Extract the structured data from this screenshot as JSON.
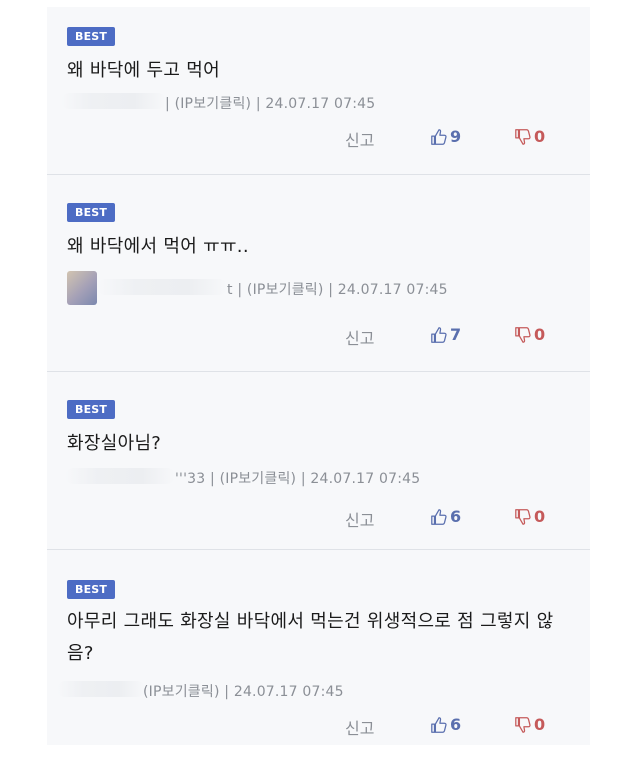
{
  "comments": [
    {
      "badge": "BEST",
      "text": "왜 바닥에 두고 먹어",
      "author_tail": "",
      "meta": "| (IP보기클릭) | 24.07.17 07:45",
      "report": "신고",
      "likes": "9",
      "dislikes": "0"
    },
    {
      "badge": "BEST",
      "text": "왜 바닥에서 먹어 ㅠㅠ..",
      "author_tail": "t",
      "meta": "| (IP보기클릭) | 24.07.17 07:45",
      "report": "신고",
      "likes": "7",
      "dislikes": "0"
    },
    {
      "badge": "BEST",
      "text": "화장실아님?",
      "author_tail": "'''33",
      "meta": "| (IP보기클릭) | 24.07.17 07:45",
      "report": "신고",
      "likes": "6",
      "dislikes": "0"
    },
    {
      "badge": "BEST",
      "text": "아무리 그래도 화장실 바닥에서 먹는건 위생적으로 점 그렇지 않음?",
      "author_tail": "",
      "meta": "(IP보기클릭) | 24.07.17 07:45",
      "report": "신고",
      "likes": "6",
      "dislikes": "0"
    }
  ],
  "icons": {
    "like": "thumbs-up-icon",
    "dislike": "thumbs-down-icon"
  },
  "colors": {
    "badge": "#4d6cc4",
    "like": "#5a6fae",
    "dislike": "#c55a5a"
  }
}
